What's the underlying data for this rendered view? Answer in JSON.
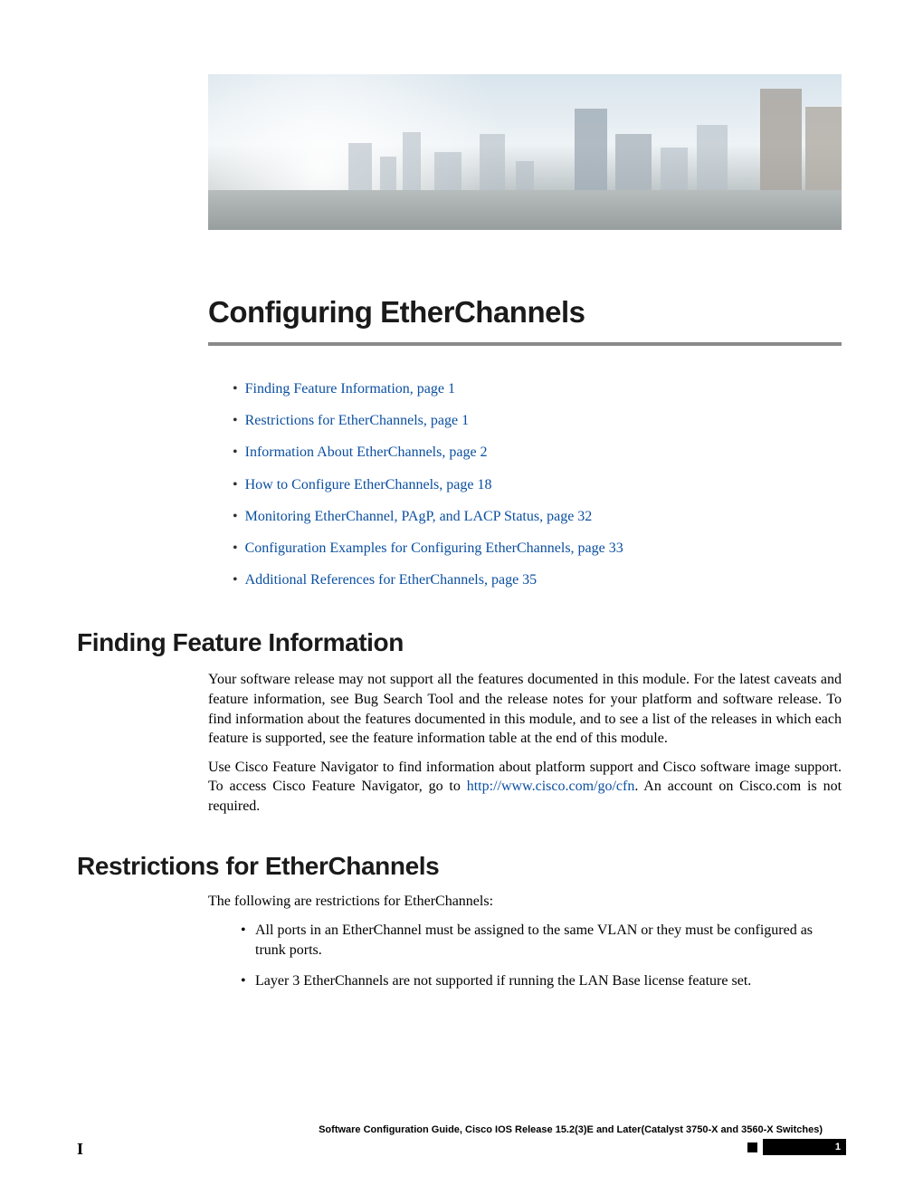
{
  "chapter_title": "Configuring EtherChannels",
  "toc": [
    {
      "text": "Finding Feature Information,  page  1"
    },
    {
      "text": "Restrictions for EtherChannels,  page  1"
    },
    {
      "text": "Information About EtherChannels,  page  2"
    },
    {
      "text": "How to Configure EtherChannels,  page  18"
    },
    {
      "text": "Monitoring EtherChannel, PAgP, and LACP Status,  page  32"
    },
    {
      "text": "Configuration Examples for Configuring EtherChannels,  page  33"
    },
    {
      "text": "Additional References for EtherChannels,  page  35"
    }
  ],
  "sections": {
    "ffi": {
      "heading": "Finding Feature Information",
      "p1": "Your software release may not support all the features documented in this module. For the latest caveats and feature information, see Bug Search Tool and the release notes for your platform and software release. To find information about the features documented in this module, and to see a list of the releases in which each feature is supported, see the feature information table at the end of this module.",
      "p2a": "Use Cisco Feature Navigator to find information about platform support and Cisco software image support. To access Cisco Feature Navigator, go to ",
      "p2_link_text": "http://www.cisco.com/go/cfn",
      "p2b": ". An account on Cisco.com is not required."
    },
    "restrict": {
      "heading": "Restrictions for EtherChannels",
      "intro": "The following are restrictions for EtherChannels:",
      "items": [
        "All ports in an EtherChannel must be assigned to the same VLAN or they must be configured as trunk ports.",
        "Layer 3 EtherChannels are not supported if running the LAN Base license feature set."
      ]
    }
  },
  "footer": {
    "guide": "Software Configuration Guide, Cisco IOS Release 15.2(3)E and Later(Catalyst 3750-X and 3560-X Switches)",
    "page": "1"
  }
}
